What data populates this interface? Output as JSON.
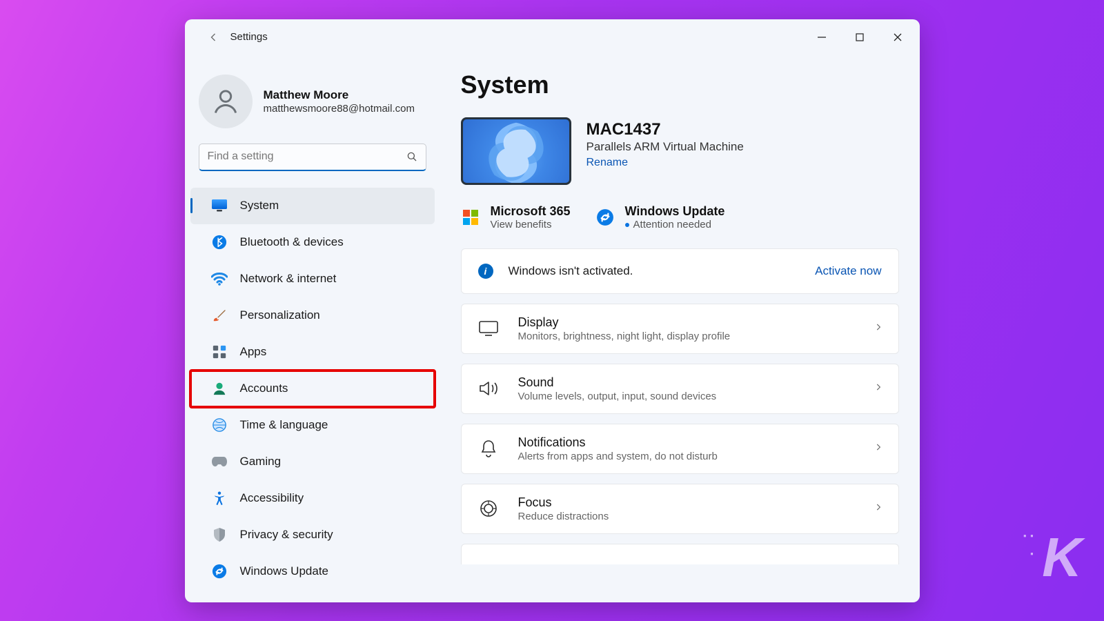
{
  "window": {
    "title": "Settings"
  },
  "profile": {
    "name": "Matthew Moore",
    "email": "matthewsmoore88@hotmail.com"
  },
  "search": {
    "placeholder": "Find a setting"
  },
  "sidebar": {
    "items": [
      {
        "label": "System"
      },
      {
        "label": "Bluetooth & devices"
      },
      {
        "label": "Network & internet"
      },
      {
        "label": "Personalization"
      },
      {
        "label": "Apps"
      },
      {
        "label": "Accounts"
      },
      {
        "label": "Time & language"
      },
      {
        "label": "Gaming"
      },
      {
        "label": "Accessibility"
      },
      {
        "label": "Privacy & security"
      },
      {
        "label": "Windows Update"
      }
    ]
  },
  "page": {
    "title": "System"
  },
  "device": {
    "name": "MAC1437",
    "desc": "Parallels ARM Virtual Machine",
    "rename": "Rename"
  },
  "tiles": {
    "m365": {
      "title": "Microsoft 365",
      "sub": "View benefits"
    },
    "update": {
      "title": "Windows Update",
      "sub": "Attention needed"
    }
  },
  "banner": {
    "text": "Windows isn't activated.",
    "link": "Activate now"
  },
  "cards": [
    {
      "title": "Display",
      "sub": "Monitors, brightness, night light, display profile"
    },
    {
      "title": "Sound",
      "sub": "Volume levels, output, input, sound devices"
    },
    {
      "title": "Notifications",
      "sub": "Alerts from apps and system, do not disturb"
    },
    {
      "title": "Focus",
      "sub": "Reduce distractions"
    }
  ],
  "highlight_index": 5,
  "colors": {
    "accent": "#0067c0",
    "link": "#0a55b3",
    "highlight_box": "#e60000"
  }
}
